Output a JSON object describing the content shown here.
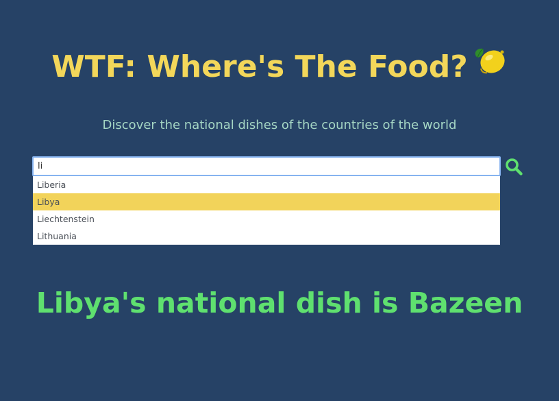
{
  "header": {
    "title": "WTF: Where's The Food?",
    "title_icon": "lemon-icon",
    "subtitle": "Discover the national dishes of the countries of the world"
  },
  "search": {
    "value": "li",
    "button_icon": "search-icon"
  },
  "suggestions": {
    "items": [
      "Liberia",
      "Libya",
      "Liechtenstein",
      "Lithuania"
    ],
    "highlighted": "Libya"
  },
  "result": {
    "text": "Libya's national dish is Bazeen"
  },
  "colors": {
    "background": "#264266",
    "title": "#f3d75a",
    "subtitle": "#a5d6c4",
    "highlight": "#f2d35a",
    "result": "#5fe06f",
    "search_icon": "#5fe06f"
  }
}
